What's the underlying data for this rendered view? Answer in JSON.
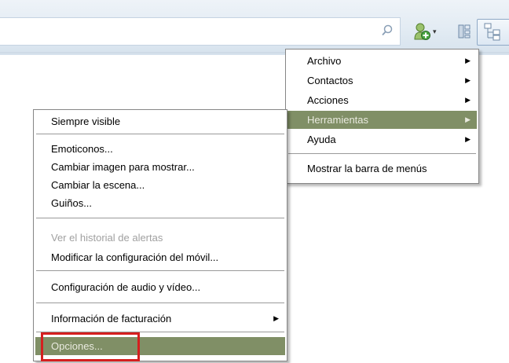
{
  "toolbar": {
    "search_placeholder": "",
    "icons": [
      "search-icon",
      "add-contact-icon",
      "layout-icon",
      "menu-layout-icon"
    ]
  },
  "main_menu": {
    "items": [
      {
        "label": "Archivo",
        "has_submenu": true
      },
      {
        "label": "Contactos",
        "has_submenu": true
      },
      {
        "label": "Acciones",
        "has_submenu": true
      },
      {
        "label": "Herramientas",
        "has_submenu": true,
        "highlighted": true
      },
      {
        "label": "Ayuda",
        "has_submenu": true
      },
      {
        "label": "Mostrar la barra de menús",
        "has_submenu": false
      }
    ]
  },
  "tools_menu": {
    "items": [
      {
        "label": "Siempre visible"
      },
      {
        "label": "Emoticonos..."
      },
      {
        "label": "Cambiar imagen para mostrar..."
      },
      {
        "label": "Cambiar la escena..."
      },
      {
        "label": "Guiños..."
      },
      {
        "label": "Ver el historial de alertas",
        "disabled": true
      },
      {
        "label": "Modificar la configuración del móvil..."
      },
      {
        "label": "Configuración de audio y vídeo..."
      },
      {
        "label": "Información de facturación",
        "has_submenu": true
      },
      {
        "label": "Opciones...",
        "highlighted": true
      }
    ]
  },
  "colors": {
    "highlight": "#808f66",
    "highlight_text": "#e9eadf",
    "annotation_box": "#d51f1f",
    "disabled_text": "#a0a0a0"
  }
}
